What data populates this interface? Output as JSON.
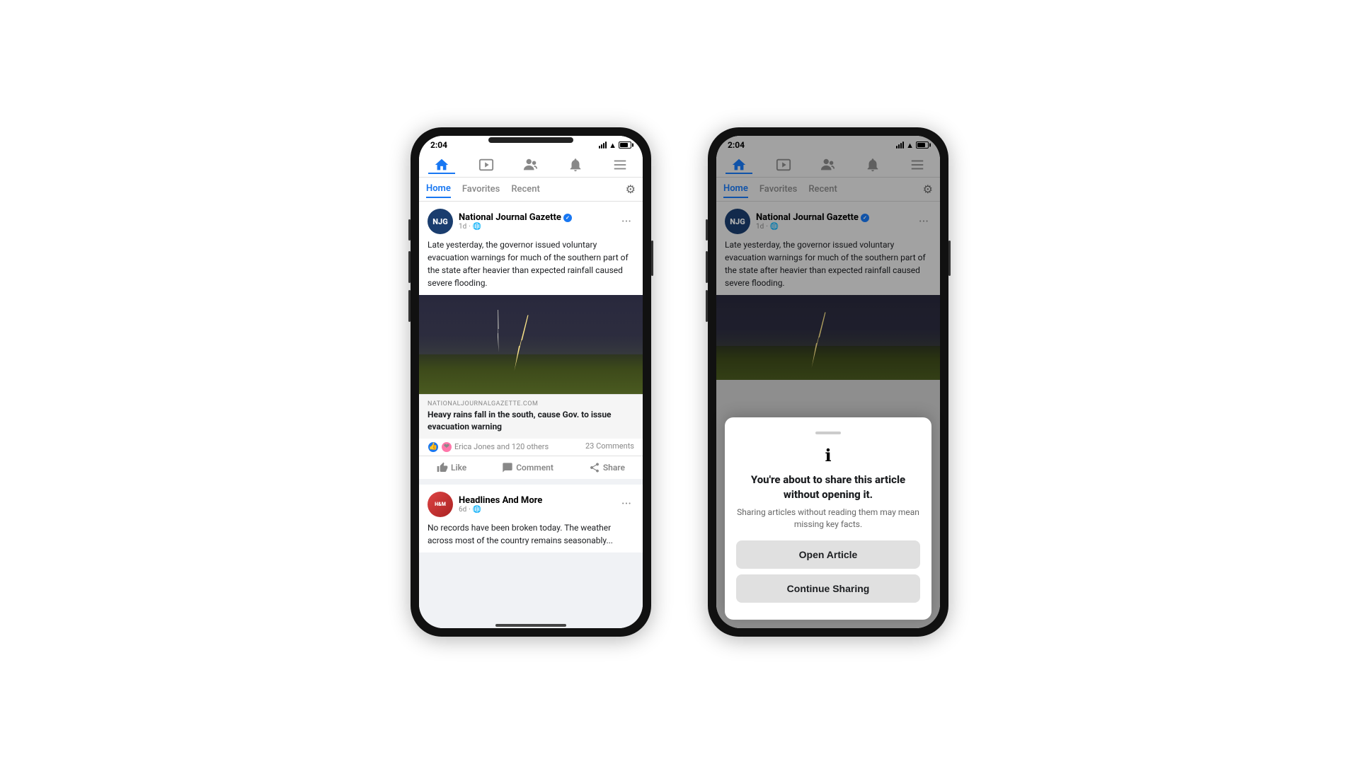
{
  "page": {
    "background": "#ffffff"
  },
  "phone1": {
    "status": {
      "time": "2:04",
      "signal": true,
      "wifi": true,
      "battery": true
    },
    "nav": {
      "items": [
        "home",
        "watch",
        "groups",
        "notifications",
        "menu"
      ]
    },
    "tabs": {
      "home": "Home",
      "favorites": "Favorites",
      "recent": "Recent"
    },
    "post1": {
      "author": "National Journal Gazette",
      "verified": true,
      "time": "1d",
      "globe": true,
      "initials": "NJG",
      "text": "Late yesterday, the governor issued voluntary evacuation warnings for much of the southern part of the state after heavier than expected rainfall caused severe flooding.",
      "link_source": "NATIONALJOURNALGAZETTE.COM",
      "link_title": "Heavy rains fall in the south, cause Gov. to issue evacuation warning",
      "reactions": "Erica Jones and 120 others",
      "comments": "23 Comments",
      "like_label": "Like",
      "comment_label": "Comment",
      "share_label": "Share"
    },
    "post2": {
      "author": "Headlines And More",
      "time": "6d",
      "globe": true,
      "initials": "H&M",
      "text": "No records have been broken today. The weather across most of the country remains seasonably..."
    }
  },
  "phone2": {
    "status": {
      "time": "2:04"
    },
    "post1": {
      "author": "National Journal Gazette",
      "verified": true,
      "time": "1d",
      "initials": "NJG",
      "text": "Late yesterday, the governor issued voluntary evacuation warnings for much of the southern part of the state after heavier than expected rainfall caused severe flooding."
    },
    "modal": {
      "drag_handle": true,
      "info_icon": "ℹ",
      "title": "You're about to share this article without opening it.",
      "subtitle": "Sharing articles without reading them may mean missing key facts.",
      "open_article_label": "Open Article",
      "continue_sharing_label": "Continue Sharing"
    }
  }
}
